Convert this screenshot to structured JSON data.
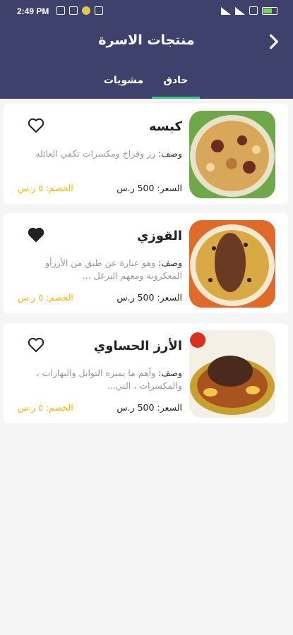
{
  "status_bar": {
    "time": "2:49 PM",
    "battery_color": "#7cd35a"
  },
  "header": {
    "title": "منتجات الاسرة",
    "back_icon": "chevron-right-icon"
  },
  "tabs": [
    {
      "label": "حادق",
      "active": true
    },
    {
      "label": "مشويات",
      "active": false
    }
  ],
  "labels": {
    "desc_prefix": "وصف:"
  },
  "products": [
    {
      "name": "كبسه",
      "description": "رز وفراخ ومكسرات تكفي العائله",
      "price": "السعر: 500 ر.س",
      "discount": "الخصم: ٥ ر.س",
      "favorite": false
    },
    {
      "name": "القوزي",
      "description": "وهو عبارة عن طبق من الأرزأو المعكرونة  ومعهم البرغل ...",
      "price": "السعر: 500 ر.س",
      "discount": "الخصم: ٥ ر.س",
      "favorite": true
    },
    {
      "name": "الأرز الحساوي",
      "description": "وأهم ما يميزه التوابل والبهارات ، والمكسرات ، التي...",
      "price": "السعر: 500 ر.س",
      "discount": "الخصم: ٥ ر.س",
      "favorite": false
    }
  ],
  "colors": {
    "primary": "#3e416b",
    "accent": "#35c98a",
    "discount": "#f2b90f"
  }
}
